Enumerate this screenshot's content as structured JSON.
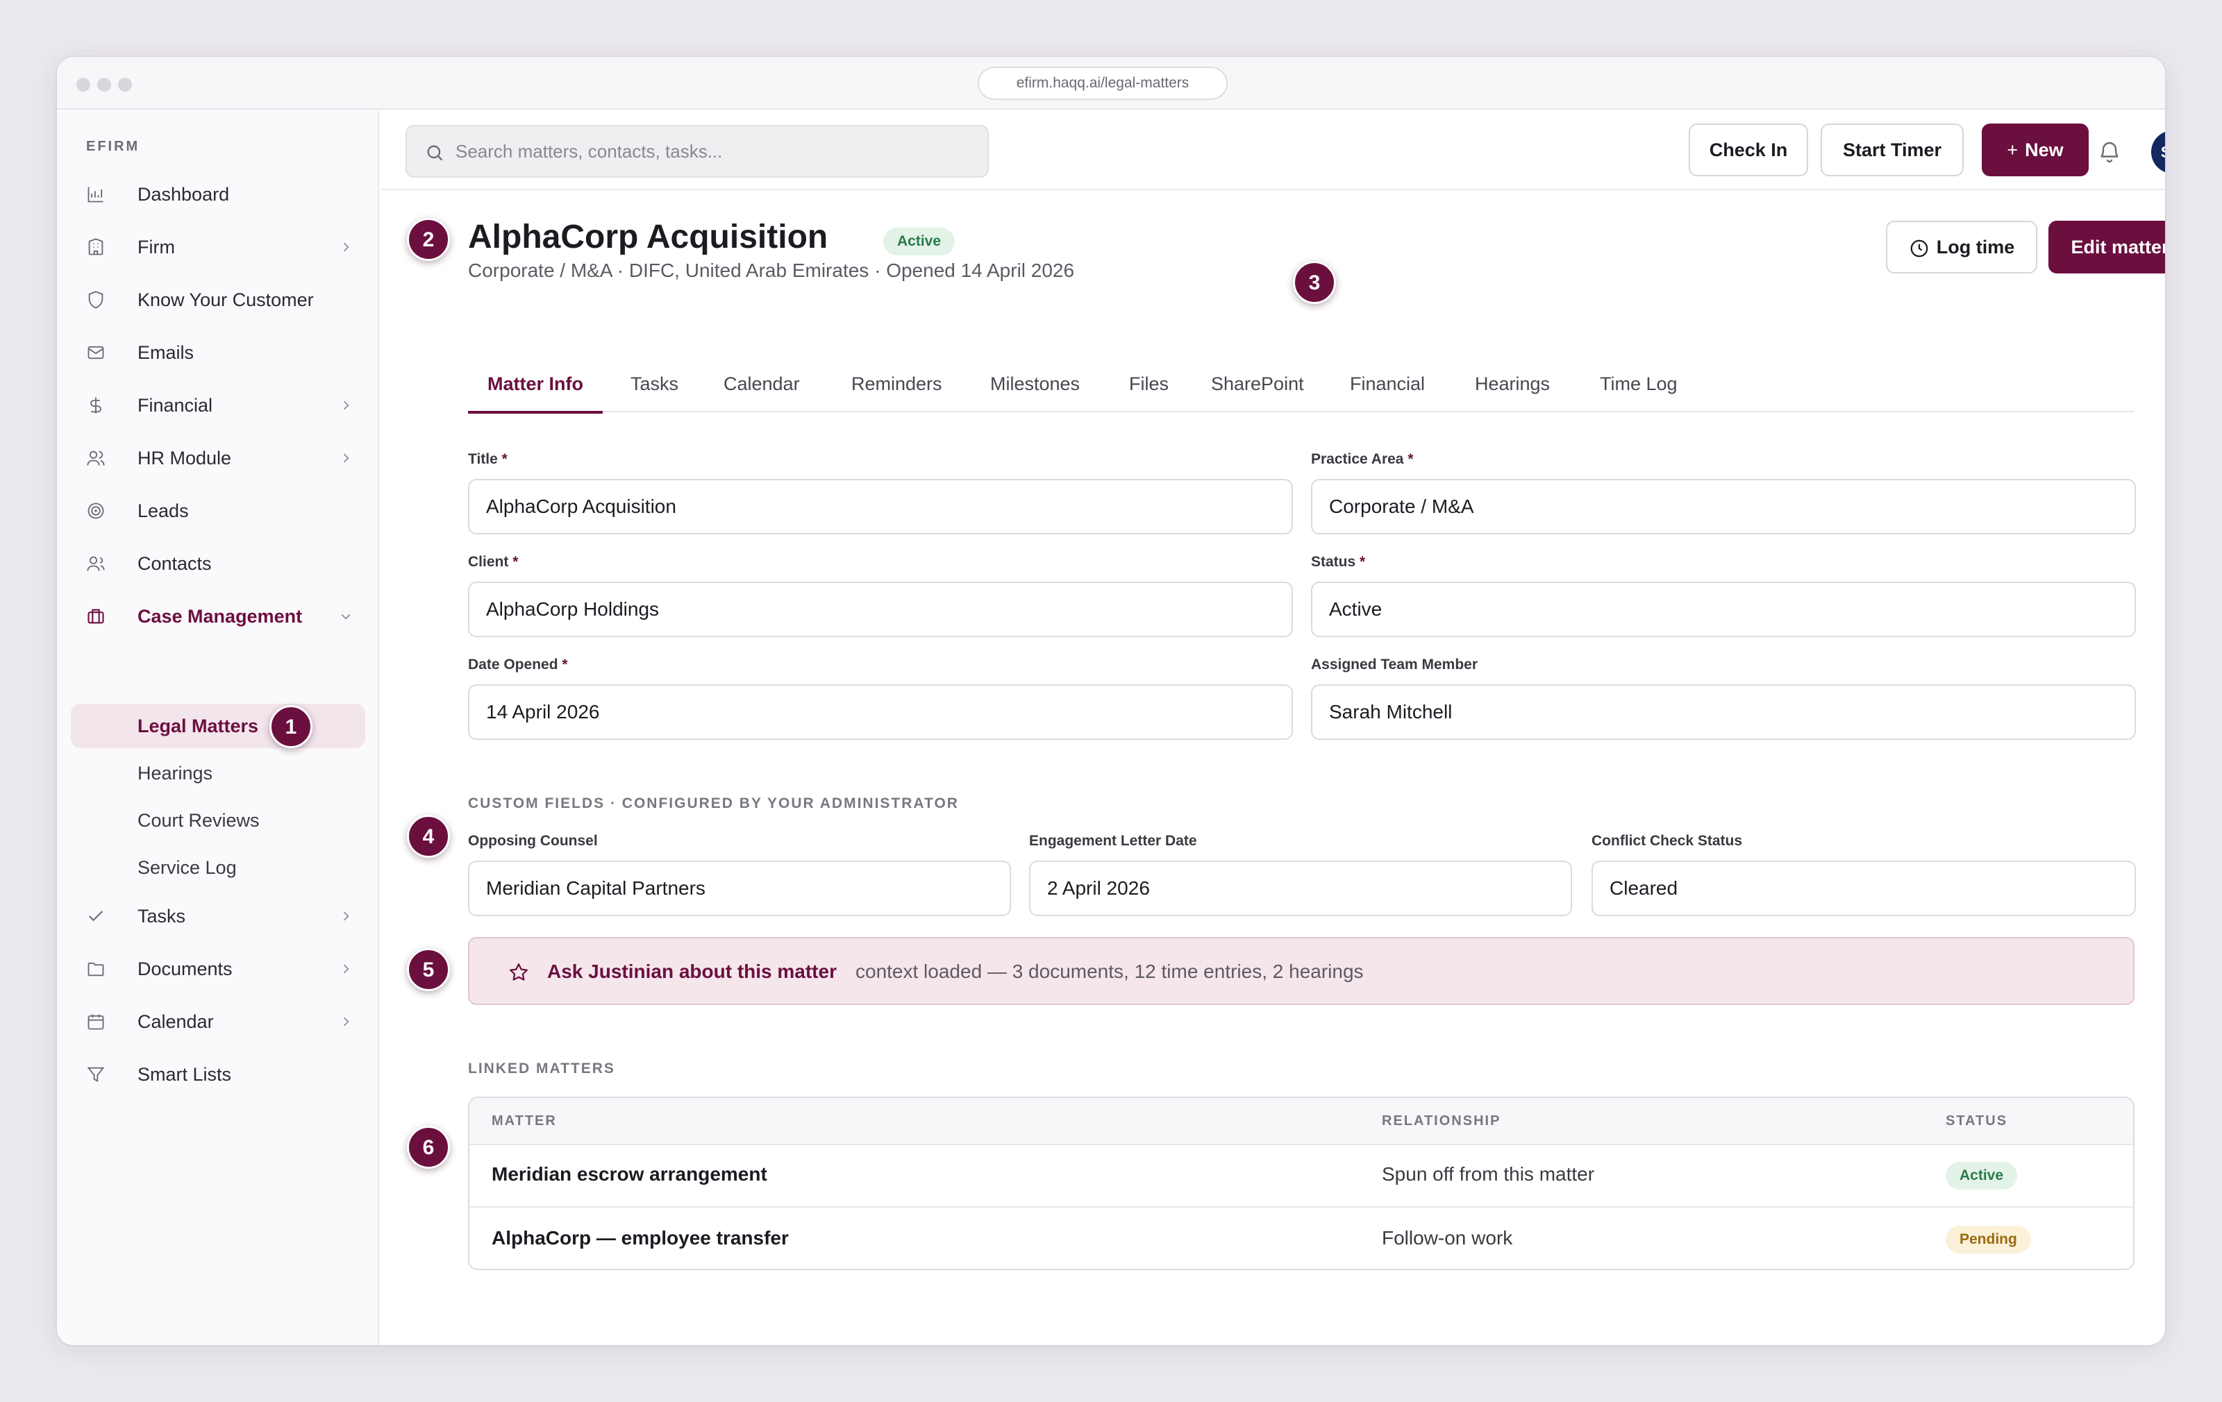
{
  "browser": {
    "url": "efirm.haqq.ai/legal-matters"
  },
  "sidebar": {
    "brand": "EFIRM",
    "items": [
      {
        "label": "Dashboard",
        "icon": "bar-chart-icon"
      },
      {
        "label": "Firm",
        "icon": "building-icon"
      },
      {
        "label": "Know Your Customer",
        "icon": "shield-icon"
      },
      {
        "label": "Emails",
        "icon": "mail-icon"
      },
      {
        "label": "Financial",
        "icon": "dollar-icon"
      },
      {
        "label": "HR Module",
        "icon": "users-icon"
      },
      {
        "label": "Leads",
        "icon": "target-icon"
      },
      {
        "label": "Contacts",
        "icon": "contacts-icon"
      },
      {
        "label": "Case Management",
        "icon": "briefcase-icon"
      },
      {
        "label": "Tasks",
        "icon": "check-icon"
      },
      {
        "label": "Documents",
        "icon": "folder-icon"
      },
      {
        "label": "Calendar",
        "icon": "calendar-icon"
      },
      {
        "label": "Smart Lists",
        "icon": "filter-icon"
      }
    ],
    "sub_items": [
      "Legal Matters",
      "Hearings",
      "Court Reviews",
      "Service Log"
    ]
  },
  "topbar": {
    "search_placeholder": "Search matters, contacts, tasks...",
    "check_in": "Check In",
    "start_timer": "Start Timer",
    "new": "New",
    "avatar": "SM"
  },
  "matter": {
    "title": "AlphaCorp Acquisition",
    "status_badge": "Active",
    "subtitle": "Corporate / M&A · DIFC, United Arab Emirates · Opened 14 April 2026",
    "log_time": "Log time",
    "edit": "Edit matter"
  },
  "tabs": [
    "Matter Info",
    "Tasks",
    "Calendar",
    "Reminders",
    "Milestones",
    "Files",
    "SharePoint",
    "Financial",
    "Hearings",
    "Time Log"
  ],
  "fields": {
    "title_label": "Title",
    "title_value": "AlphaCorp Acquisition",
    "practice_label": "Practice Area",
    "practice_value": "Corporate / M&A",
    "client_label": "Client",
    "client_value": "AlphaCorp Holdings",
    "status_label": "Status",
    "status_value": "Active",
    "opened_label": "Date Opened",
    "opened_value": "14 April 2026",
    "assigned_label": "Assigned Team Member",
    "assigned_value": "Sarah Mitchell",
    "required_mark": "*"
  },
  "custom_fields": {
    "heading": "CUSTOM FIELDS · CONFIGURED BY YOUR ADMINISTRATOR",
    "opposing_label": "Opposing Counsel",
    "opposing_value": "Meridian Capital Partners",
    "engagement_label": "Engagement Letter Date",
    "engagement_value": "2 April 2026",
    "conflict_label": "Conflict Check Status",
    "conflict_value": "Cleared"
  },
  "ask": {
    "title": "Ask Justinian about this matter",
    "context": "context loaded — 3 documents, 12 time entries, 2 hearings"
  },
  "linked": {
    "heading": "LINKED MATTERS",
    "columns": [
      "MATTER",
      "RELATIONSHIP",
      "STATUS"
    ],
    "rows": [
      {
        "matter": "Meridian escrow arrangement",
        "relationship": "Spun off from this matter",
        "status": "Active"
      },
      {
        "matter": "AlphaCorp — employee transfer",
        "relationship": "Follow-on work",
        "status": "Pending"
      }
    ]
  },
  "callouts": [
    "1",
    "2",
    "3",
    "4",
    "5",
    "6"
  ],
  "colors": {
    "accent": "#6b0f3f",
    "avatar": "#13285e",
    "active_bg": "#e3f3e8",
    "pending_bg": "#fbf1d9"
  }
}
